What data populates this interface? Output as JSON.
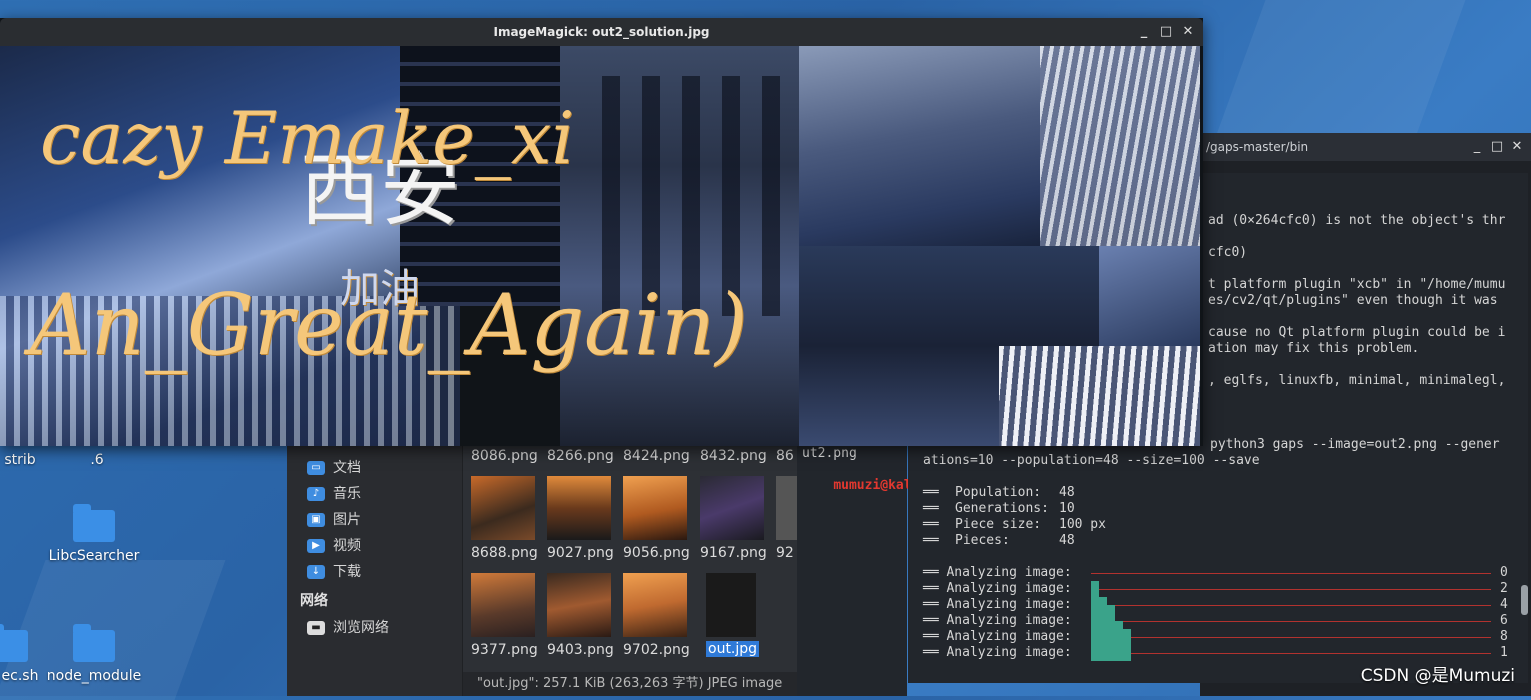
{
  "imagemagick": {
    "title": "ImageMagick: out2_solution.jpg",
    "handwriting_line1": "cazy Emake_xi",
    "handwriting_line2": "An_Great_Again)",
    "overlay_chars_1": "西安",
    "overlay_chars_2": "加油"
  },
  "desktop": {
    "icons": [
      {
        "label": "strib"
      },
      {
        "label": ".6"
      },
      {
        "label": "LibcSearcher"
      },
      {
        "label": "ec.sh"
      },
      {
        "label": "node_module"
      }
    ]
  },
  "file_manager": {
    "sidebar": [
      {
        "label": "文档",
        "icon": "document-icon"
      },
      {
        "label": "音乐",
        "icon": "music-icon"
      },
      {
        "label": "图片",
        "icon": "picture-icon"
      },
      {
        "label": "视频",
        "icon": "video-icon"
      },
      {
        "label": "下载",
        "icon": "download-icon"
      }
    ],
    "network_header": "网络",
    "browse_network": "浏览网络",
    "files_row1": [
      "8086.png",
      "8266.png",
      "8424.png",
      "8432.png",
      "86"
    ],
    "files_row2": [
      "8688.png",
      "9027.png",
      "9056.png",
      "9167.png",
      "92"
    ],
    "files_row3": [
      "9377.png",
      "9403.png",
      "9702.png",
      "out.jpg"
    ],
    "status": "\"out.jpg\": 257.1 KiB (263,263 字节) JPEG image"
  },
  "mid_terminal": {
    "line1": "ut2.png",
    "prompt": "mumuzi@kali",
    "prompt_suffix": ":~"
  },
  "terminal": {
    "title": "/gaps-master/bin",
    "lines": [
      "ad (0×264cfc0) is not the object's thr",
      "cfc0)",
      "t platform plugin \"xcb\" in \"/home/mumu",
      "es/cv2/qt/plugins\" even though it was",
      "cause no Qt platform plugin could be i",
      "ation may fix this problem.",
      ", eglfs, linuxfb, minimal, minimalegl,",
      "python3 gaps --image=out2.png --gener",
      "ations=10 --population=48 --size=100 --save"
    ],
    "stats": [
      {
        "label": "Population:",
        "value": "48"
      },
      {
        "label": "Generations:",
        "value": "10"
      },
      {
        "label": "Piece size:",
        "value": "100 px"
      },
      {
        "label": "Pieces:",
        "value": "48"
      }
    ],
    "analyzing_label": "Analyzing image:",
    "progress_values": [
      "0",
      "2",
      "4",
      "6",
      "8",
      "1"
    ]
  },
  "watermark": "CSDN @是Mumuzi"
}
